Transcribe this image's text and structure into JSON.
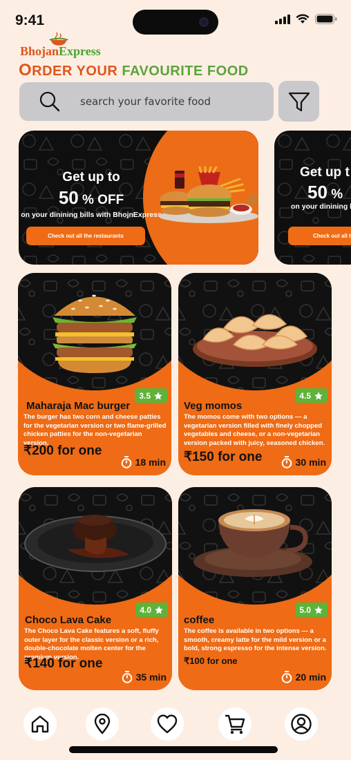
{
  "status_bar": {
    "time": "9:41"
  },
  "brand": {
    "name_part1": "Bhojan",
    "name_part2": "Express"
  },
  "tagline": {
    "part1_big": "O",
    "part1_rest": "RDER YOUR ",
    "part2": "FAVOURITE FOOD"
  },
  "search": {
    "placeholder": "search your favorite food"
  },
  "banners": [
    {
      "line1": "Get up to",
      "percent": "50",
      "percent_suffix": " % OFF",
      "line3": "on your dinining bills with BhojnExpress",
      "cta": "Check out all the restaurants"
    },
    {
      "line1": "Get up t",
      "percent": "50",
      "percent_suffix": " %",
      "line3": "on your dinining bills",
      "cta": "Check out all th"
    }
  ],
  "dishes": [
    {
      "name": "Maharaja Mac burger",
      "rating": "3.5",
      "description": "The burger has two corn and cheese patties for the vegetarian version or two flame-grilled chicken patties for the non-vegetarian version.",
      "price": "₹200 for one",
      "time": "18 min"
    },
    {
      "name": "Veg momos",
      "rating": "4.5",
      "description": "The momos come with two options — a vegetarian version filled with finely chopped vegetables and cheese, or a non-vegetarian version packed with juicy, seasoned chicken.",
      "price": "₹150 for one",
      "time": "30 min"
    },
    {
      "name": "Choco Lava Cake",
      "rating": "4.0",
      "description": "The Choco Lava Cake features a soft, fluffy outer layer for the classic version or a rich, double-chocolate molten center for the premium version.",
      "price": "₹140 for one",
      "time": "35 min"
    },
    {
      "name": "coffee",
      "rating": "5.0",
      "description": "The coffee is available in two options — a smooth, creamy latte for the mild version or a bold, strong espresso for the intense version.",
      "price": "₹100 for one",
      "time": "20 min"
    }
  ],
  "bottom_nav": [
    "home-icon",
    "location-icon",
    "heart-icon",
    "cart-icon",
    "profile-icon"
  ],
  "colors": {
    "accent": "#ef6b15",
    "brand_green": "#5aa43a",
    "rating_green": "#5fb23a",
    "background": "#fdeee4"
  }
}
